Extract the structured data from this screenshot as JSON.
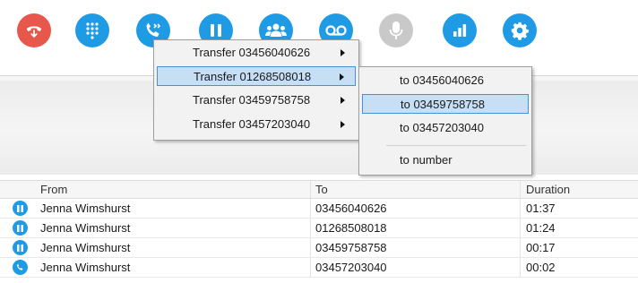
{
  "toolbar": {
    "buttons": [
      {
        "icon": "phone-hangup-icon",
        "color": "#e8574b"
      },
      {
        "icon": "dialpad-icon",
        "color": "#1f9be6"
      },
      {
        "icon": "transfer-call-icon",
        "color": "#1f9be6"
      },
      {
        "icon": "pause-icon",
        "color": "#1f9be6"
      },
      {
        "icon": "conference-icon",
        "color": "#1f9be6"
      },
      {
        "icon": "voicemail-icon",
        "color": "#1f9be6"
      },
      {
        "icon": "microphone-icon",
        "color": "#c9c9c9"
      },
      {
        "icon": "stats-icon",
        "color": "#1f9be6"
      },
      {
        "icon": "settings-icon",
        "color": "#1f9be6"
      }
    ]
  },
  "transfer_menu": {
    "items": [
      {
        "label": "Transfer 03456040626",
        "selected": false
      },
      {
        "label": "Transfer 01268508018",
        "selected": true
      },
      {
        "label": "Transfer 03459758758",
        "selected": false
      },
      {
        "label": "Transfer 03457203040",
        "selected": false
      }
    ]
  },
  "transfer_submenu": {
    "items": [
      {
        "label": "to 03456040626",
        "selected": false
      },
      {
        "label": "to 03459758758",
        "selected": true
      },
      {
        "label": "to 03457203040",
        "selected": false
      },
      {
        "label": "to number",
        "selected": false
      }
    ]
  },
  "calls_table": {
    "columns": [
      "From",
      "To",
      "Duration"
    ],
    "rows": [
      {
        "icon": "pause-icon",
        "from": "Jenna Wimshurst",
        "to": "03456040626",
        "duration": "01:37"
      },
      {
        "icon": "pause-icon",
        "from": "Jenna Wimshurst",
        "to": "01268508018",
        "duration": "01:24"
      },
      {
        "icon": "pause-icon",
        "from": "Jenna Wimshurst",
        "to": "03459758758",
        "duration": "00:17"
      },
      {
        "icon": "phone-icon",
        "from": "Jenna Wimshurst",
        "to": "03457203040",
        "duration": "00:02"
      }
    ]
  },
  "colors": {
    "accent": "#1f9be6",
    "hangup": "#e8574b",
    "disabled": "#c9c9c9",
    "menu_highlight": "#c6dff5"
  }
}
